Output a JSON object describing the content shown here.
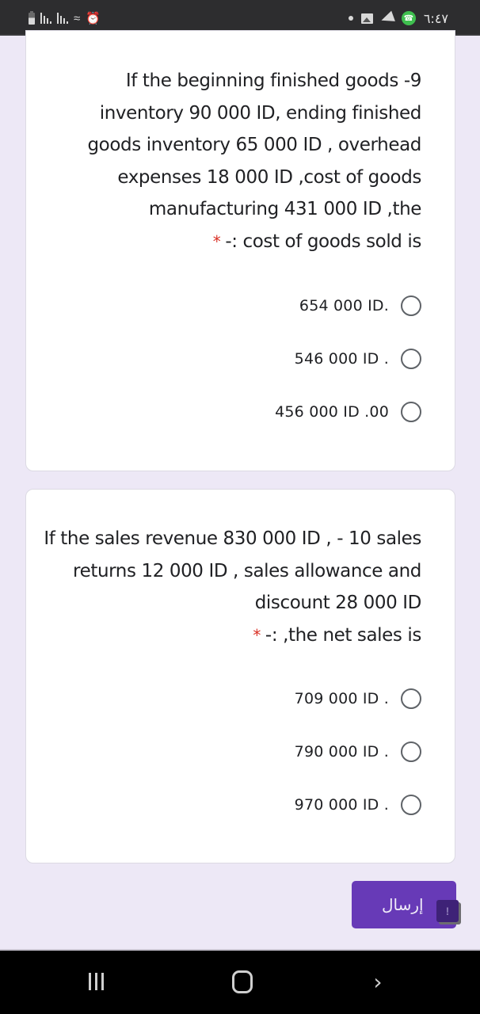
{
  "status_bar": {
    "time": "٦:٤٧",
    "left_icons": [
      "battery-icon",
      "signal-icon",
      "signal-icon",
      "wifi-icon",
      "alarm-icon"
    ],
    "right_icons": [
      "notification-dot-icon",
      "gallery-icon",
      "telegram-icon",
      "whatsapp-icon"
    ]
  },
  "questions": [
    {
      "number": "9",
      "text": "If the beginning finished goods -9 inventory 90 000 ID, ending finished goods inventory 65 000 ID , overhead expenses 18 000 ID ,cost of goods manufacturing 431 000 ID ,the",
      "text_last": "-: cost of goods sold is",
      "required_mark": "*",
      "options": [
        "654 000 ID.",
        "546 000 ID .",
        "456 000 ID .00"
      ],
      "selected": null
    },
    {
      "number": "10",
      "text": "If the sales revenue 830 000 ID , - 10 sales returns 12 000 ID , sales allowance and discount 28 000 ID",
      "text_last": "-: ,the net sales is",
      "required_mark": "*",
      "options": [
        "709 000 ID .",
        "790 000 ID .",
        "970 000 ID ."
      ],
      "selected": null
    }
  ],
  "submit_button": {
    "label": "إرسال"
  },
  "feedback_badge": {
    "label": "!"
  },
  "colors": {
    "accent": "#673ab7",
    "background": "#ede8f6",
    "required": "#d93025"
  }
}
